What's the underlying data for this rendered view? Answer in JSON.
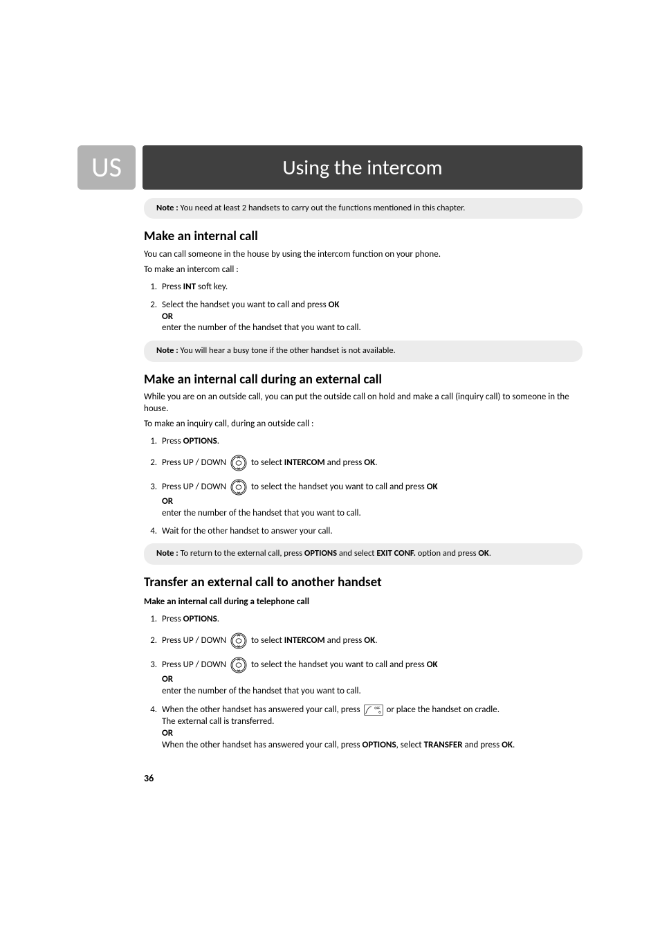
{
  "page": {
    "lang_tab": "US",
    "title": "Using the intercom",
    "number": "36"
  },
  "notes": {
    "intro": "You need at least 2 handsets to carry out the functions mentioned in this chapter.",
    "busy": "You will hear a busy tone if the other handset is not available.",
    "return_prefix": "To return to the external call, press ",
    "return_mid": " and select ",
    "return_suffix": " option and press ",
    "note_label": "Note : "
  },
  "section1": {
    "heading": "Make an internal call",
    "intro": "You can call someone in the house by using the intercom function on your phone.",
    "sub": "To make an intercom call :",
    "step1_pre": "Press ",
    "step1_bold": "INT",
    "step1_post": " soft key.",
    "step2_pre": "Select the handset you want to call and press ",
    "step2_bold": "OK",
    "or": "OR",
    "step2_cont": "enter the number of the handset that you want to call."
  },
  "section2": {
    "heading": "Make an internal call during an external call",
    "intro": "While you are on an outside call, you can put the outside call on hold and make a call (inquiry call) to someone in the house.",
    "sub": "To make an inquiry call, during an outside call :",
    "step1_pre": "Press ",
    "step1_bold": "OPTIONS",
    "step2_pre": "Press UP / DOWN ",
    "step2_mid": " to select ",
    "step2_bold": "INTERCOM",
    "step2_mid2": " and press ",
    "ok": "OK",
    "step3_pre": "Press UP / DOWN ",
    "step3_mid": " to select the handset you want to call and press ",
    "or": "OR",
    "step3_cont": "enter the number of the handset that you want to call.",
    "step4": "Wait for the other handset to answer your call."
  },
  "section3": {
    "heading": "Transfer an external call to another handset",
    "subhead": "Make an internal call during a telephone call",
    "step1_pre": "Press ",
    "step1_bold": "OPTIONS",
    "step2_pre": "Press UP / DOWN ",
    "step2_mid": " to select ",
    "step2_bold": "INTERCOM",
    "step2_mid2": " and press ",
    "ok": "OK",
    "step3_pre": "Press UP / DOWN ",
    "step3_mid": " to select the handset you want to call and press ",
    "or": "OR",
    "step3_cont": "enter the number of the handset that you want to call.",
    "step4_pre": "When the other handset has answered your call, press ",
    "step4_post": " or place the handset on cradle.",
    "step4_line2": "The external call is transferred.",
    "step4_cont": "When the other handset has answered your call, press ",
    "step4_bold1": "OPTIONS",
    "step4_sep1": ", select ",
    "step4_bold2": "TRANSFER",
    "step4_sep2": " and press ",
    "exit_conf": "EXIT CONF."
  },
  "period": "."
}
